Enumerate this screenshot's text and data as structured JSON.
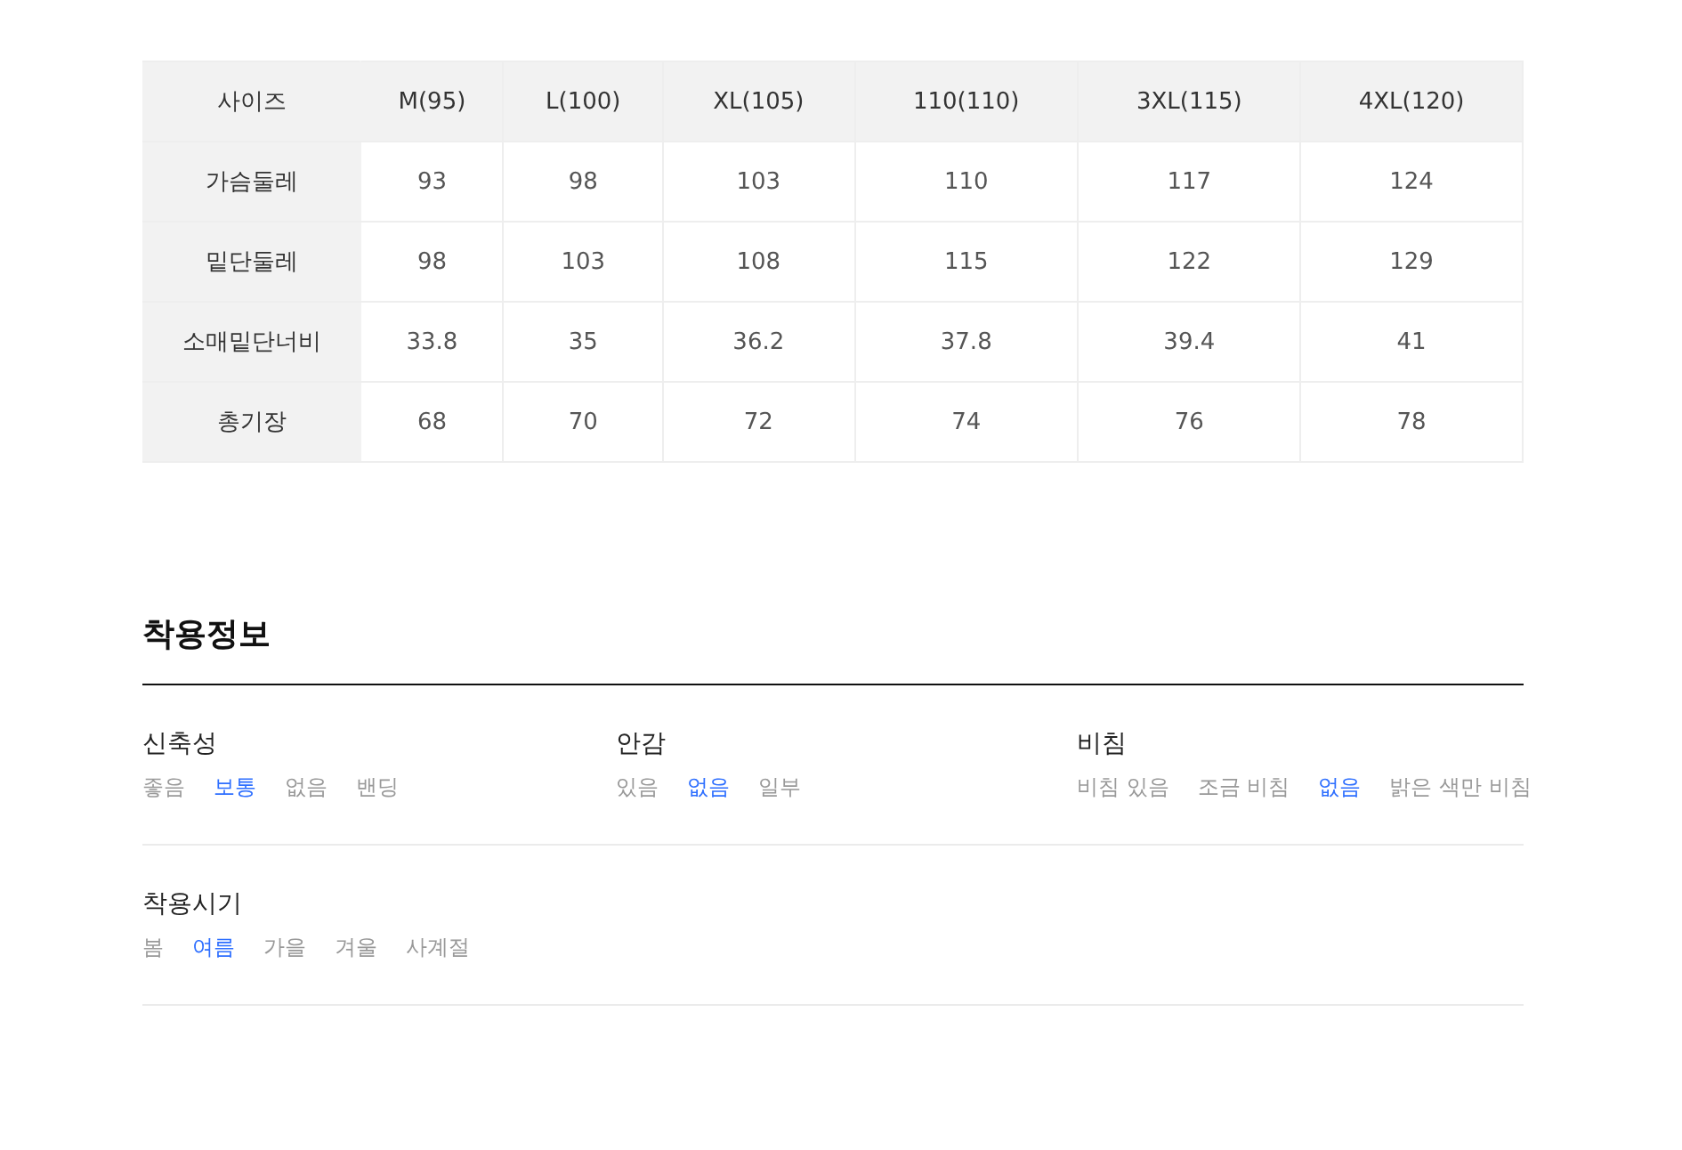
{
  "size_table": {
    "columns": [
      "사이즈",
      "M(95)",
      "L(100)",
      "XL(105)",
      "110(110)",
      "3XL(115)",
      "4XL(120)"
    ],
    "rows": [
      {
        "label": "가슴둘레",
        "values": [
          "93",
          "98",
          "103",
          "110",
          "117",
          "124"
        ]
      },
      {
        "label": "밑단둘레",
        "values": [
          "98",
          "103",
          "108",
          "115",
          "122",
          "129"
        ]
      },
      {
        "label": "소매밑단너비",
        "values": [
          "33.8",
          "35",
          "36.2",
          "37.8",
          "39.4",
          "41"
        ]
      },
      {
        "label": "총기장",
        "values": [
          "68",
          "70",
          "72",
          "74",
          "76",
          "78"
        ]
      }
    ]
  },
  "fit_info": {
    "title": "착용정보",
    "rows": [
      [
        {
          "label": "신축성",
          "options": [
            {
              "text": "좋음",
              "selected": false
            },
            {
              "text": "보통",
              "selected": true
            },
            {
              "text": "없음",
              "selected": false
            },
            {
              "text": "밴딩",
              "selected": false
            }
          ]
        },
        {
          "label": "안감",
          "options": [
            {
              "text": "있음",
              "selected": false
            },
            {
              "text": "없음",
              "selected": true
            },
            {
              "text": "일부",
              "selected": false
            }
          ]
        },
        {
          "label": "비침",
          "options": [
            {
              "text": "비침 있음",
              "selected": false
            },
            {
              "text": "조금 비침",
              "selected": false
            },
            {
              "text": "없음",
              "selected": true
            },
            {
              "text": "밝은 색만 비침",
              "selected": false
            }
          ]
        }
      ],
      [
        {
          "label": "착용시기",
          "options": [
            {
              "text": "봄",
              "selected": false
            },
            {
              "text": "여름",
              "selected": true
            },
            {
              "text": "가을",
              "selected": false
            },
            {
              "text": "겨울",
              "selected": false
            },
            {
              "text": "사계절",
              "selected": false
            }
          ]
        }
      ]
    ]
  }
}
